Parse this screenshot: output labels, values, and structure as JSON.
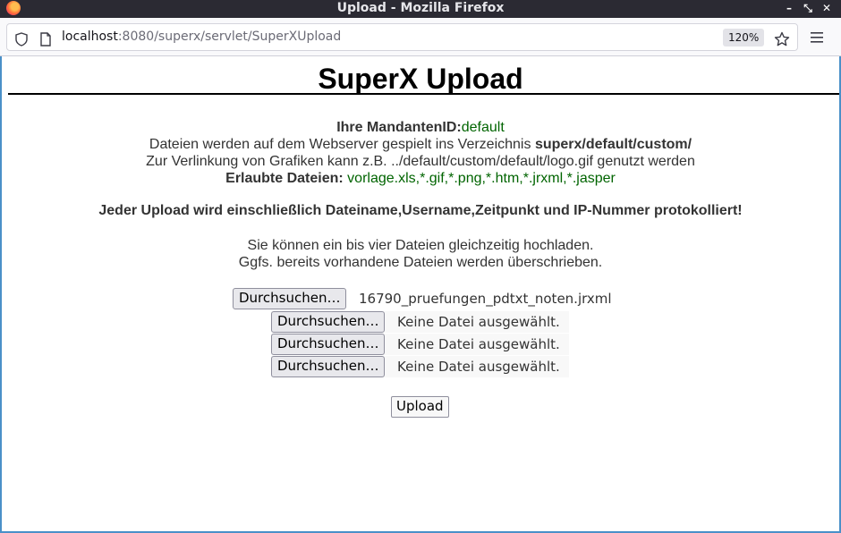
{
  "window": {
    "title": "Upload - Mozilla Firefox",
    "controls": {
      "minimize": "–",
      "restore": "⤡",
      "close": "✕"
    }
  },
  "browser": {
    "url_host": "localhost",
    "url_rest": ":8080/superx/servlet/SuperXUpload",
    "zoom": "120%"
  },
  "page": {
    "title": "SuperX Upload",
    "mandant_label": "Ihre MandantenID:",
    "mandant_value": "default",
    "dir_text": "Dateien werden auf dem Webserver gespielt ins Verzeichnis ",
    "dir_path": "superx/default/custom/",
    "link_text": "Zur Verlinkung von Grafiken kann z.B. ../default/custom/default/logo.gif genutzt werden",
    "allowed_label": "Erlaubte Dateien:",
    "allowed_value": " vorlage.xls,*.gif,*.png,*.htm,*.jrxml,*.jasper",
    "warning": "Jeder Upload wird einschließlich Dateiname,Username,Zeitpunkt und IP-Nummer protokolliert!",
    "hint1": "Sie können ein bis vier Dateien gleichzeitig hochladen.",
    "hint2": "Ggfs. bereits vorhandene Dateien werden überschrieben.",
    "file_inputs": [
      {
        "button": "Durchsuchen…",
        "status": "16790_pruefungen_pdtxt_noten.jrxml"
      },
      {
        "button": "Durchsuchen…",
        "status": "Keine Datei ausgewählt."
      },
      {
        "button": "Durchsuchen…",
        "status": "Keine Datei ausgewählt."
      },
      {
        "button": "Durchsuchen…",
        "status": "Keine Datei ausgewählt."
      }
    ],
    "upload_button": "Upload"
  },
  "colors": {
    "titlebar": "#2b2a33",
    "accent_green": "#006400",
    "frame_blue": "#4a90c8"
  }
}
